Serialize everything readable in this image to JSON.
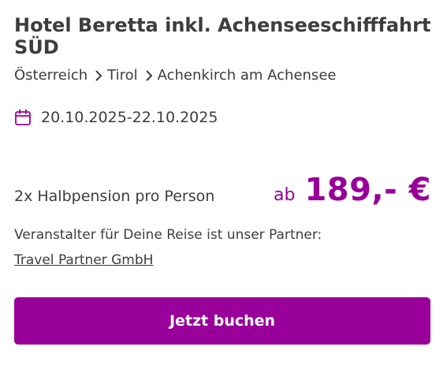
{
  "offer": {
    "title": "Hotel Beretta inkl. Achenseeschifffahrt SÜD",
    "breadcrumb": [
      {
        "label": "Österreich"
      },
      {
        "label": "Tirol"
      },
      {
        "label": "Achenkirch am Achensee"
      }
    ],
    "breadcrumb_separator_icon": "chevron-right-icon",
    "date_icon": "calendar-icon",
    "dates": "20.10.2025-22.10.2025",
    "board": "2x Halbpension pro Person",
    "price": {
      "prefix": "ab",
      "amount": "189,- €"
    },
    "operator_text": "Veranstalter für Deine Reise ist unser Partner:",
    "operator_name": "Travel Partner GmbH",
    "book_button_label": "Jetzt buchen"
  },
  "colors": {
    "accent": "#990099",
    "text": "#3d3d3d",
    "background": "#ffffff"
  }
}
